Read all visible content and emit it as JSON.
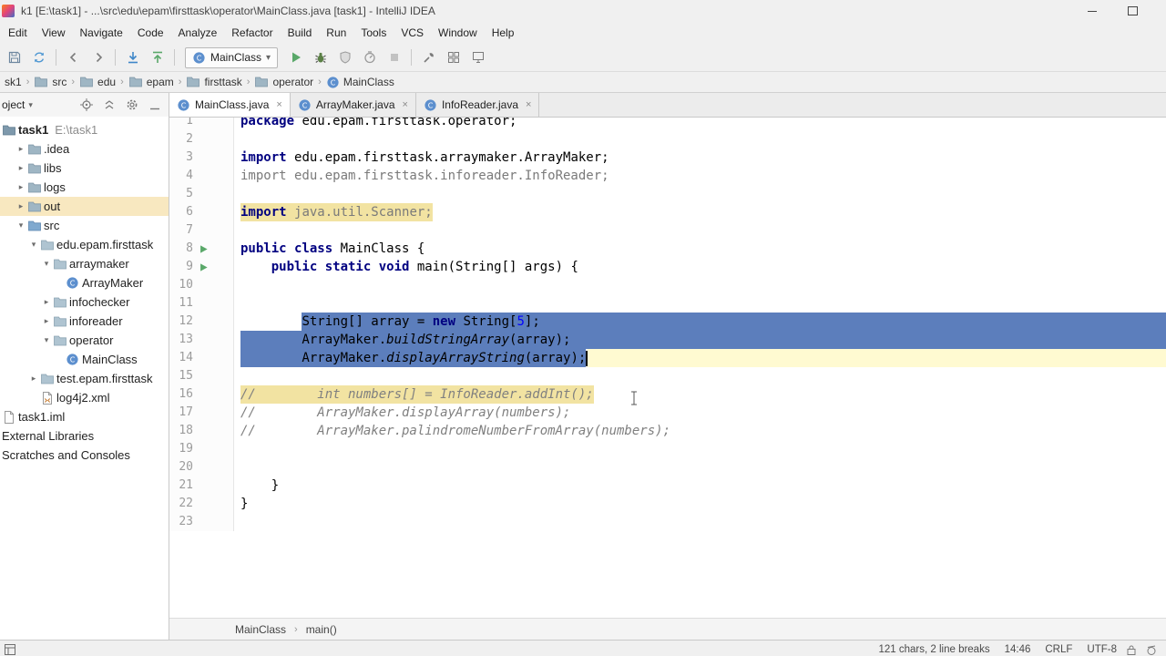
{
  "colors": {
    "selection_blue": "#5C7EBC",
    "warning_highlight": "#F2E3A2",
    "current_line": "#FFFAD1",
    "excluded_row": "#F8E8C0",
    "keyword_navy": "#000080",
    "comment_gray": "#808080",
    "number_blue": "#0000FF",
    "run_green": "#59A869"
  },
  "titlebar": {
    "title": "k1 [E:\\task1] - ...\\src\\edu\\epam\\firsttask\\operator\\MainClass.java [task1] - IntelliJ IDEA"
  },
  "menubar": {
    "items": [
      "Edit",
      "View",
      "Navigate",
      "Code",
      "Analyze",
      "Refactor",
      "Build",
      "Run",
      "Tools",
      "VCS",
      "Window",
      "Help"
    ]
  },
  "toolbar": {
    "items": [
      {
        "type": "icon",
        "name": "save"
      },
      {
        "type": "icon",
        "name": "sync"
      },
      {
        "type": "sep"
      },
      {
        "type": "icon",
        "name": "back"
      },
      {
        "type": "icon",
        "name": "forward"
      },
      {
        "type": "sep"
      },
      {
        "type": "icon",
        "name": "update-project"
      },
      {
        "type": "icon",
        "name": "commit"
      },
      {
        "type": "sep"
      },
      {
        "type": "combo",
        "label": "MainClass"
      },
      {
        "type": "icon",
        "name": "run"
      },
      {
        "type": "icon",
        "name": "debug"
      },
      {
        "type": "icon",
        "name": "coverage"
      },
      {
        "type": "icon",
        "name": "profiler"
      },
      {
        "type": "icon",
        "name": "stop"
      },
      {
        "type": "sep"
      },
      {
        "type": "icon",
        "name": "tools"
      },
      {
        "type": "icon",
        "name": "grid"
      },
      {
        "type": "icon",
        "name": "structure"
      }
    ]
  },
  "navbar": {
    "crumbs": [
      {
        "label": "sk1",
        "icon": null
      },
      {
        "label": "src",
        "icon": "folder"
      },
      {
        "label": "edu",
        "icon": "folder"
      },
      {
        "label": "epam",
        "icon": "folder"
      },
      {
        "label": "firsttask",
        "icon": "folder"
      },
      {
        "label": "operator",
        "icon": "folder"
      },
      {
        "label": "MainClass",
        "icon": "class"
      }
    ]
  },
  "project": {
    "header": {
      "title": "oject",
      "icons": [
        "locate",
        "collapse-all",
        "settings",
        "hide"
      ]
    },
    "tree": [
      {
        "label": "task1",
        "extra": "E:\\task1",
        "icon": "folder-project",
        "depth": 0,
        "arrow": null,
        "bold": true
      },
      {
        "label": ".idea",
        "icon": "folder",
        "depth": 1,
        "arrow": "right"
      },
      {
        "label": "libs",
        "icon": "folder",
        "depth": 1,
        "arrow": "right"
      },
      {
        "label": "logs",
        "icon": "folder",
        "depth": 1,
        "arrow": "right"
      },
      {
        "label": "out",
        "icon": "folder",
        "depth": 1,
        "arrow": "right",
        "highlight": "excluded"
      },
      {
        "label": "src",
        "icon": "folder-src",
        "depth": 1,
        "arrow": "down"
      },
      {
        "label": "edu.epam.firsttask",
        "icon": "package",
        "depth": 2,
        "arrow": "down"
      },
      {
        "label": "arraymaker",
        "icon": "package",
        "depth": 3,
        "arrow": "down"
      },
      {
        "label": "ArrayMaker",
        "icon": "class",
        "depth": 4,
        "arrow": "none"
      },
      {
        "label": "infochecker",
        "icon": "package",
        "depth": 3,
        "arrow": "right"
      },
      {
        "label": "inforeader",
        "icon": "package",
        "depth": 3,
        "arrow": "right"
      },
      {
        "label": "operator",
        "icon": "package",
        "depth": 3,
        "arrow": "down"
      },
      {
        "label": "MainClass",
        "icon": "class",
        "depth": 4,
        "arrow": "none"
      },
      {
        "label": "test.epam.firsttask",
        "icon": "package",
        "depth": 2,
        "arrow": "right"
      },
      {
        "label": "log4j2.xml",
        "icon": "file-xml",
        "depth": 2,
        "arrow": "none"
      },
      {
        "label": "task1.iml",
        "icon": "file",
        "depth": 0,
        "arrow": null
      },
      {
        "label": "External Libraries",
        "icon": null,
        "depth": 0,
        "arrow": null
      },
      {
        "label": "Scratches and Consoles",
        "icon": null,
        "depth": 0,
        "arrow": null
      }
    ]
  },
  "tabs": {
    "items": [
      {
        "label": "MainClass.java",
        "icon": "class",
        "active": true
      },
      {
        "label": "ArrayMaker.java",
        "icon": "class",
        "active": false
      },
      {
        "label": "InfoReader.java",
        "icon": "class",
        "active": false
      }
    ]
  },
  "editor": {
    "lines": [
      {
        "n": 1,
        "seg": [
          {
            "t": "package ",
            "c": "kw"
          },
          {
            "t": "edu.epam.firsttask.operator;",
            "c": "pl"
          }
        ]
      },
      {
        "n": 2,
        "seg": []
      },
      {
        "n": 3,
        "seg": [
          {
            "t": "import ",
            "c": "kw"
          },
          {
            "t": "edu.epam.firsttask.arraymaker.ArrayMaker;",
            "c": "pl"
          }
        ]
      },
      {
        "n": 4,
        "seg": [
          {
            "t": "import edu.epam.firsttask.inforeader.InfoReader;",
            "c": "gr"
          }
        ]
      },
      {
        "n": 5,
        "seg": []
      },
      {
        "n": 6,
        "seg": [
          {
            "t": "import ",
            "c": "kw",
            "bg": "warn"
          },
          {
            "t": "java.util.Scanner;",
            "c": "gr",
            "bg": "warn"
          }
        ]
      },
      {
        "n": 7,
        "seg": []
      },
      {
        "n": 8,
        "gutter": "run",
        "seg": [
          {
            "t": "public class ",
            "c": "kw"
          },
          {
            "t": "MainClass {",
            "c": "pl"
          }
        ]
      },
      {
        "n": 9,
        "gutter": "run",
        "seg": [
          {
            "t": "    ",
            "c": "pl"
          },
          {
            "t": "public static void ",
            "c": "kw"
          },
          {
            "t": "main(String[] args) {",
            "c": "pl"
          }
        ]
      },
      {
        "n": 10,
        "seg": []
      },
      {
        "n": 11,
        "seg": []
      },
      {
        "n": 12,
        "fill": "sel",
        "seg": [
          {
            "t": "        ",
            "c": "pl"
          },
          {
            "t": "String[] array = ",
            "c": "pl",
            "bg": "sel"
          },
          {
            "t": "new ",
            "c": "kw",
            "bg": "sel"
          },
          {
            "t": "String[",
            "c": "pl",
            "bg": "sel"
          },
          {
            "t": "5",
            "c": "num",
            "bg": "sel"
          },
          {
            "t": "];",
            "c": "pl",
            "bg": "sel"
          }
        ]
      },
      {
        "n": 13,
        "fill": "sel",
        "seg": [
          {
            "t": "        ArrayMaker.",
            "c": "pl",
            "bg": "sel"
          },
          {
            "t": "buildStringArray",
            "c": "mth",
            "bg": "sel"
          },
          {
            "t": "(array);",
            "c": "pl",
            "bg": "sel"
          }
        ]
      },
      {
        "n": 14,
        "fill": "cur",
        "caret": true,
        "seg": [
          {
            "t": "        ArrayMaker.",
            "c": "pl",
            "bg": "sel"
          },
          {
            "t": "displayArrayString",
            "c": "mth",
            "bg": "sel"
          },
          {
            "t": "(array);",
            "c": "pl",
            "bg": "sel"
          }
        ]
      },
      {
        "n": 15,
        "seg": []
      },
      {
        "n": 16,
        "seg": [
          {
            "t": "//        int numbers[] = InfoReader.addInt();",
            "c": "cm",
            "bg": "warn"
          }
        ]
      },
      {
        "n": 17,
        "seg": [
          {
            "t": "//        ArrayMaker.displayArray(numbers);",
            "c": "cm"
          }
        ]
      },
      {
        "n": 18,
        "seg": [
          {
            "t": "//        ArrayMaker.palindromeNumberFromArray(numbers);",
            "c": "cm"
          }
        ]
      },
      {
        "n": 19,
        "seg": []
      },
      {
        "n": 20,
        "seg": []
      },
      {
        "n": 21,
        "seg": [
          {
            "t": "    }",
            "c": "pl"
          }
        ]
      },
      {
        "n": 22,
        "seg": [
          {
            "t": "}",
            "c": "pl"
          }
        ]
      },
      {
        "n": 23,
        "seg": []
      }
    ]
  },
  "bottom_breadcrumbs": {
    "items": [
      "MainClass",
      "main()"
    ],
    "separator": "›"
  },
  "statusbar": {
    "selection_info": "121 chars, 2 line breaks",
    "caret_position": "14:46",
    "line_ending": "CRLF",
    "encoding": "UTF-8"
  }
}
